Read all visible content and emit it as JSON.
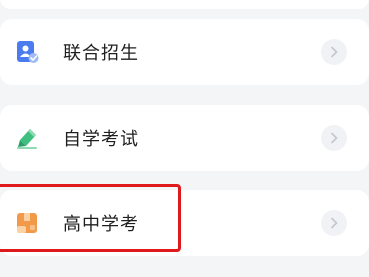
{
  "menu": {
    "items": [
      {
        "label": "联合招生",
        "icon": "joint-enrollment-icon",
        "icon_color": "#4a7cf0"
      },
      {
        "label": "自学考试",
        "icon": "self-study-exam-icon",
        "icon_color": "#3fbf7f"
      },
      {
        "label": "高中学考",
        "icon": "high-school-exam-icon",
        "icon_color": "#f39a4a"
      }
    ]
  },
  "annotation": {
    "highlight_color": "#e0191c"
  }
}
